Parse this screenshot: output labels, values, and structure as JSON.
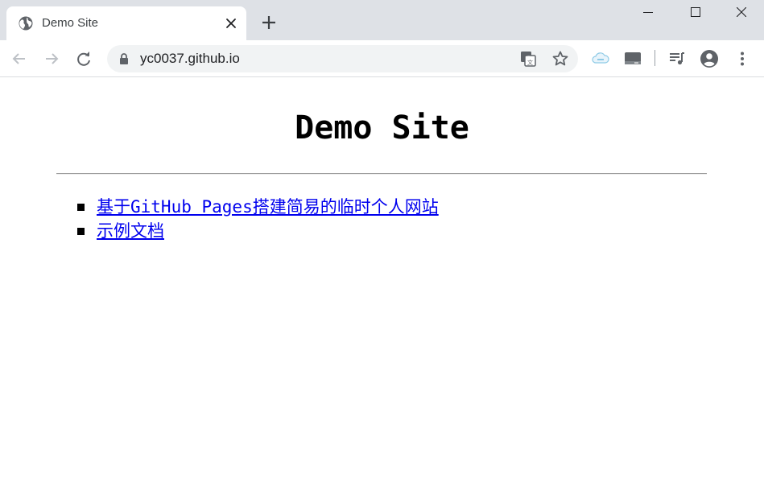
{
  "browser": {
    "tab": {
      "title": "Demo Site",
      "favicon": "globe-icon"
    },
    "address_bar": {
      "url": "yc0037.github.io",
      "secure_icon": "lock-icon"
    },
    "window_controls": [
      "minimize-icon",
      "maximize-icon",
      "close-icon"
    ]
  },
  "page": {
    "title": "Demo Site",
    "links": [
      {
        "label": "基于GitHub Pages搭建简易的临时个人网站"
      },
      {
        "label": "示例文档"
      }
    ]
  },
  "colors": {
    "tabstrip": "#dee1e6",
    "omnibox": "#f1f3f4",
    "link": "#0000ee",
    "icon": "#5f6368"
  }
}
